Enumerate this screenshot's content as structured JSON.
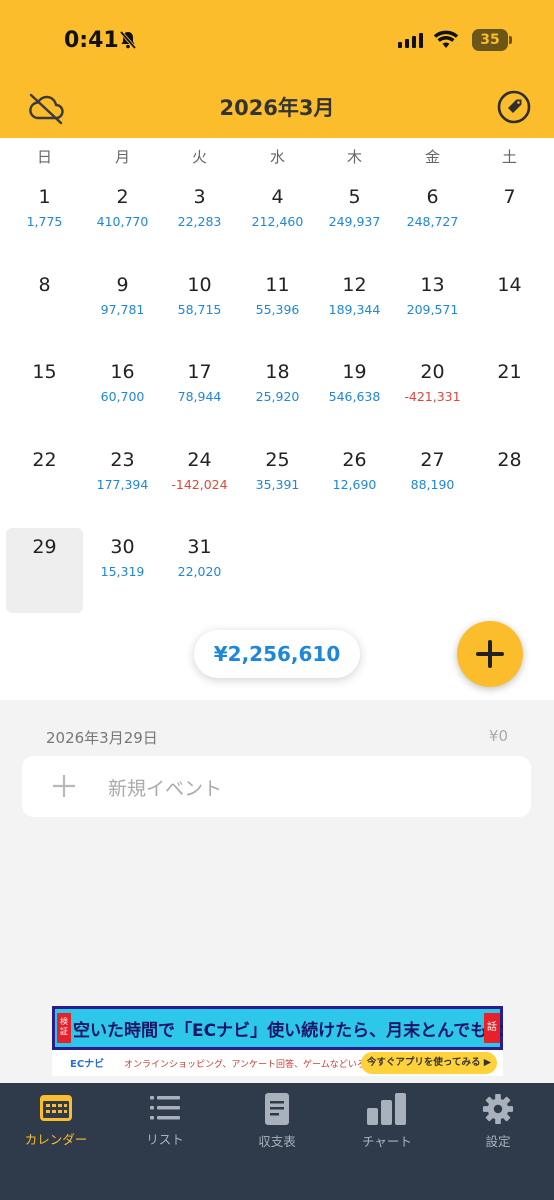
{
  "status_bar": {
    "time": "0:41",
    "battery": "35"
  },
  "header": {
    "title": "2026年3月",
    "left_icon": "cloud-off-icon",
    "right_icon": "tag-icon"
  },
  "calendar": {
    "weekdays": [
      "日",
      "月",
      "火",
      "水",
      "木",
      "金",
      "土"
    ],
    "days": [
      {
        "day": "1",
        "amount": "1,775"
      },
      {
        "day": "2",
        "amount": "410,770"
      },
      {
        "day": "3",
        "amount": "22,283"
      },
      {
        "day": "4",
        "amount": "212,460"
      },
      {
        "day": "5",
        "amount": "249,937"
      },
      {
        "day": "6",
        "amount": "248,727"
      },
      {
        "day": "7",
        "amount": ""
      },
      {
        "day": "8",
        "amount": ""
      },
      {
        "day": "9",
        "amount": "97,781"
      },
      {
        "day": "10",
        "amount": "58,715"
      },
      {
        "day": "11",
        "amount": "55,396"
      },
      {
        "day": "12",
        "amount": "189,344"
      },
      {
        "day": "13",
        "amount": "209,571"
      },
      {
        "day": "14",
        "amount": ""
      },
      {
        "day": "15",
        "amount": ""
      },
      {
        "day": "16",
        "amount": "60,700"
      },
      {
        "day": "17",
        "amount": "78,944"
      },
      {
        "day": "18",
        "amount": "25,920"
      },
      {
        "day": "19",
        "amount": "546,638"
      },
      {
        "day": "20",
        "amount": "-421,331"
      },
      {
        "day": "21",
        "amount": ""
      },
      {
        "day": "22",
        "amount": ""
      },
      {
        "day": "23",
        "amount": "177,394"
      },
      {
        "day": "24",
        "amount": "-142,024"
      },
      {
        "day": "25",
        "amount": "35,391"
      },
      {
        "day": "26",
        "amount": "12,690"
      },
      {
        "day": "27",
        "amount": "88,190"
      },
      {
        "day": "28",
        "amount": ""
      },
      {
        "day": "29",
        "amount": "",
        "selected": true
      },
      {
        "day": "30",
        "amount": "15,319"
      },
      {
        "day": "31",
        "amount": "22,020"
      }
    ],
    "month_total": "¥2,256,610",
    "colors": {
      "positive": "#1e87d9",
      "negative": "#e4453a",
      "accent": "#fbbd2c"
    }
  },
  "day_detail": {
    "date": "2026年3月29日",
    "total": "¥0",
    "new_event_label": "新規イベント"
  },
  "ad": {
    "badge_left": "検証",
    "headline": "空いた時間で「ECナビ」使い続けたら、月末とんでもないポイント貯まってる",
    "badge_right": "話",
    "logo": "ECナビ",
    "subtext": "オンラインショッピング、アンケート回答、ゲームなどいろんな方法でポイントが貯まる",
    "cta": "今すぐアプリを使ってみる ▶"
  },
  "tabbar": {
    "tabs": [
      {
        "label": "カレンダー",
        "icon": "calendar-icon",
        "active": true
      },
      {
        "label": "リスト",
        "icon": "list-icon",
        "active": false
      },
      {
        "label": "収支表",
        "icon": "document-icon",
        "active": false
      },
      {
        "label": "チャート",
        "icon": "bar-chart-icon",
        "active": false
      },
      {
        "label": "設定",
        "icon": "gear-icon",
        "active": false
      }
    ]
  }
}
